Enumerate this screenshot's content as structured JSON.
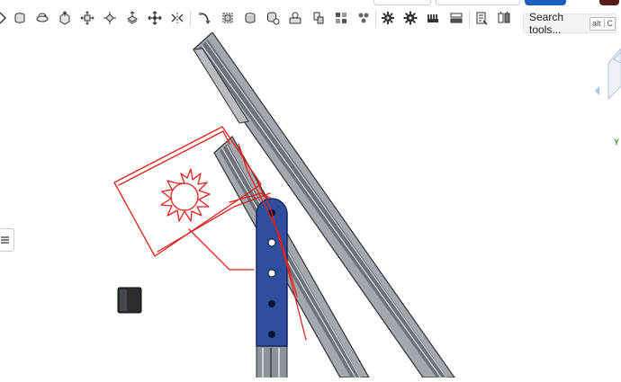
{
  "toolbar": {
    "tools": [
      {
        "name": "revolve-tool-icon"
      },
      {
        "name": "sweep-tool-icon"
      },
      {
        "name": "loft-tool-icon"
      },
      {
        "name": "extrude-tool-icon"
      },
      {
        "name": "move-face-tool-icon"
      },
      {
        "name": "offset-tool-icon"
      },
      {
        "name": "transform-tool-icon"
      },
      {
        "name": "mirror-tool-icon"
      },
      {
        "name": "sweep-path-tool-icon"
      },
      {
        "name": "bounding-box-tool-icon"
      },
      {
        "name": "shell-tool-icon"
      },
      {
        "name": "boolean-tool-icon"
      },
      {
        "name": "mate-connector-tool-icon"
      },
      {
        "name": "split-tool-icon"
      },
      {
        "name": "pattern-tool-icon"
      },
      {
        "name": "variable-tool-icon"
      },
      {
        "name": "gear-tool-icon"
      },
      {
        "name": "spur-gear-tool-icon"
      },
      {
        "name": "rack-tool-icon"
      },
      {
        "name": "list-tool-icon"
      },
      {
        "name": "bill-of-materials-tool-icon"
      },
      {
        "name": "configuration-tool-icon"
      }
    ],
    "search": {
      "label": "Search tools...",
      "shortcut_modifier": "alt",
      "shortcut_key": "C"
    }
  },
  "viewport": {
    "axis_label": "Y",
    "colors": {
      "rail": "#8e9399",
      "rail_edge": "#3a3d42",
      "bracket": "#2f4f9e",
      "sketch": "#e0201c"
    }
  }
}
